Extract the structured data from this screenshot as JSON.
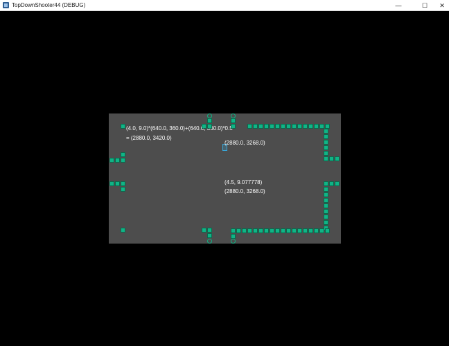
{
  "window": {
    "title": "TopDownShooter44 (DEBUG)",
    "minimize_glyph": "—",
    "maximize_glyph": "☐",
    "close_glyph": "✕"
  },
  "debug": {
    "formula_line1": "(4.0, 9.0)*(640.0, 360.0)+(640.0, 360.0)*0.5",
    "formula_line2": "= (2880.0, 3420.0)",
    "player_pos": "(2880.0, 3268.0)",
    "tile_coord": "(4.5, 9.077778)",
    "world_pos": "(2880.0, 3268.0)"
  },
  "colors": {
    "tile": "#10b486",
    "floor": "#4d4d4d",
    "background": "#000000"
  }
}
